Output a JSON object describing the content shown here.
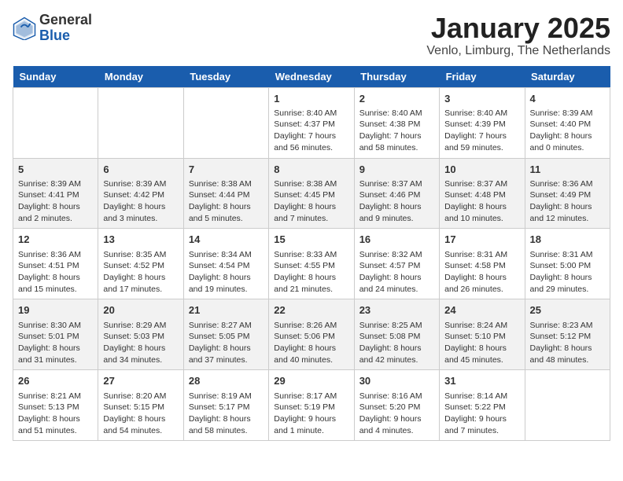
{
  "header": {
    "logo_general": "General",
    "logo_blue": "Blue",
    "title": "January 2025",
    "subtitle": "Venlo, Limburg, The Netherlands"
  },
  "days_of_week": [
    "Sunday",
    "Monday",
    "Tuesday",
    "Wednesday",
    "Thursday",
    "Friday",
    "Saturday"
  ],
  "weeks": [
    [
      {
        "day": "",
        "info": ""
      },
      {
        "day": "",
        "info": ""
      },
      {
        "day": "",
        "info": ""
      },
      {
        "day": "1",
        "info": "Sunrise: 8:40 AM\nSunset: 4:37 PM\nDaylight: 7 hours\nand 56 minutes."
      },
      {
        "day": "2",
        "info": "Sunrise: 8:40 AM\nSunset: 4:38 PM\nDaylight: 7 hours\nand 58 minutes."
      },
      {
        "day": "3",
        "info": "Sunrise: 8:40 AM\nSunset: 4:39 PM\nDaylight: 7 hours\nand 59 minutes."
      },
      {
        "day": "4",
        "info": "Sunrise: 8:39 AM\nSunset: 4:40 PM\nDaylight: 8 hours\nand 0 minutes."
      }
    ],
    [
      {
        "day": "5",
        "info": "Sunrise: 8:39 AM\nSunset: 4:41 PM\nDaylight: 8 hours\nand 2 minutes."
      },
      {
        "day": "6",
        "info": "Sunrise: 8:39 AM\nSunset: 4:42 PM\nDaylight: 8 hours\nand 3 minutes."
      },
      {
        "day": "7",
        "info": "Sunrise: 8:38 AM\nSunset: 4:44 PM\nDaylight: 8 hours\nand 5 minutes."
      },
      {
        "day": "8",
        "info": "Sunrise: 8:38 AM\nSunset: 4:45 PM\nDaylight: 8 hours\nand 7 minutes."
      },
      {
        "day": "9",
        "info": "Sunrise: 8:37 AM\nSunset: 4:46 PM\nDaylight: 8 hours\nand 9 minutes."
      },
      {
        "day": "10",
        "info": "Sunrise: 8:37 AM\nSunset: 4:48 PM\nDaylight: 8 hours\nand 10 minutes."
      },
      {
        "day": "11",
        "info": "Sunrise: 8:36 AM\nSunset: 4:49 PM\nDaylight: 8 hours\nand 12 minutes."
      }
    ],
    [
      {
        "day": "12",
        "info": "Sunrise: 8:36 AM\nSunset: 4:51 PM\nDaylight: 8 hours\nand 15 minutes."
      },
      {
        "day": "13",
        "info": "Sunrise: 8:35 AM\nSunset: 4:52 PM\nDaylight: 8 hours\nand 17 minutes."
      },
      {
        "day": "14",
        "info": "Sunrise: 8:34 AM\nSunset: 4:54 PM\nDaylight: 8 hours\nand 19 minutes."
      },
      {
        "day": "15",
        "info": "Sunrise: 8:33 AM\nSunset: 4:55 PM\nDaylight: 8 hours\nand 21 minutes."
      },
      {
        "day": "16",
        "info": "Sunrise: 8:32 AM\nSunset: 4:57 PM\nDaylight: 8 hours\nand 24 minutes."
      },
      {
        "day": "17",
        "info": "Sunrise: 8:31 AM\nSunset: 4:58 PM\nDaylight: 8 hours\nand 26 minutes."
      },
      {
        "day": "18",
        "info": "Sunrise: 8:31 AM\nSunset: 5:00 PM\nDaylight: 8 hours\nand 29 minutes."
      }
    ],
    [
      {
        "day": "19",
        "info": "Sunrise: 8:30 AM\nSunset: 5:01 PM\nDaylight: 8 hours\nand 31 minutes."
      },
      {
        "day": "20",
        "info": "Sunrise: 8:29 AM\nSunset: 5:03 PM\nDaylight: 8 hours\nand 34 minutes."
      },
      {
        "day": "21",
        "info": "Sunrise: 8:27 AM\nSunset: 5:05 PM\nDaylight: 8 hours\nand 37 minutes."
      },
      {
        "day": "22",
        "info": "Sunrise: 8:26 AM\nSunset: 5:06 PM\nDaylight: 8 hours\nand 40 minutes."
      },
      {
        "day": "23",
        "info": "Sunrise: 8:25 AM\nSunset: 5:08 PM\nDaylight: 8 hours\nand 42 minutes."
      },
      {
        "day": "24",
        "info": "Sunrise: 8:24 AM\nSunset: 5:10 PM\nDaylight: 8 hours\nand 45 minutes."
      },
      {
        "day": "25",
        "info": "Sunrise: 8:23 AM\nSunset: 5:12 PM\nDaylight: 8 hours\nand 48 minutes."
      }
    ],
    [
      {
        "day": "26",
        "info": "Sunrise: 8:21 AM\nSunset: 5:13 PM\nDaylight: 8 hours\nand 51 minutes."
      },
      {
        "day": "27",
        "info": "Sunrise: 8:20 AM\nSunset: 5:15 PM\nDaylight: 8 hours\nand 54 minutes."
      },
      {
        "day": "28",
        "info": "Sunrise: 8:19 AM\nSunset: 5:17 PM\nDaylight: 8 hours\nand 58 minutes."
      },
      {
        "day": "29",
        "info": "Sunrise: 8:17 AM\nSunset: 5:19 PM\nDaylight: 9 hours\nand 1 minute."
      },
      {
        "day": "30",
        "info": "Sunrise: 8:16 AM\nSunset: 5:20 PM\nDaylight: 9 hours\nand 4 minutes."
      },
      {
        "day": "31",
        "info": "Sunrise: 8:14 AM\nSunset: 5:22 PM\nDaylight: 9 hours\nand 7 minutes."
      },
      {
        "day": "",
        "info": ""
      }
    ]
  ]
}
